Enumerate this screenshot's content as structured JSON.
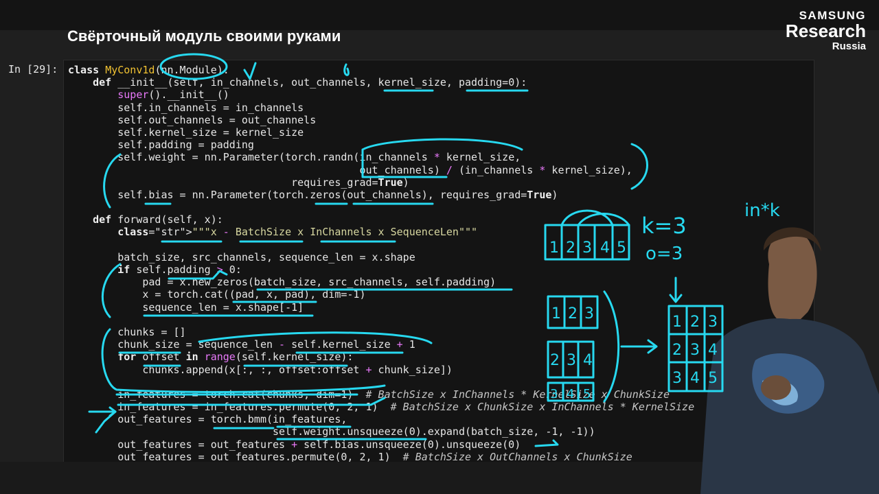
{
  "slide": {
    "title": "Свёрточный модуль своими руками",
    "brand": {
      "line1": "SAMSUNG",
      "line2": "Research",
      "line3": "Russia"
    }
  },
  "cell": {
    "prompt": "In [29]:",
    "lines": [
      "class MyConv1d(nn.Module):",
      "    def __init__(self, in_channels, out_channels, kernel_size, padding=0):",
      "        super().__init__()",
      "        self.in_channels = in_channels",
      "        self.out_channels = out_channels",
      "        self.kernel_size = kernel_size",
      "        self.padding = padding",
      "        self.weight = nn.Parameter(torch.randn(in_channels * kernel_size,",
      "                                               out_channels) / (in_channels * kernel_size),",
      "                                    requires_grad=True)",
      "        self.bias = nn.Parameter(torch.zeros(out_channels), requires_grad=True)",
      "",
      "    def forward(self, x):",
      "        \"\"\"x - BatchSize x InChannels x SequenceLen\"\"\"",
      "",
      "        batch_size, src_channels, sequence_len = x.shape",
      "        if self.padding > 0:",
      "            pad = x.new_zeros(batch_size, src_channels, self.padding)",
      "            x = torch.cat((pad, x, pad), dim=-1)",
      "            sequence_len = x.shape[-1]",
      "",
      "        chunks = []",
      "        chunk_size = sequence_len - self.kernel_size + 1",
      "        for offset in range(self.kernel_size):",
      "            chunks.append(x[:, :, offset:offset + chunk_size])",
      "",
      "        in_features = torch.cat(chunks, dim=1)  # BatchSize x InChannels * KernelSize x ChunkSize",
      "        in_features = in_features.permute(0, 2, 1)  # BatchSize x ChunkSize x InChannels * KernelSize",
      "        out_features = torch.bmm(in_features,",
      "                                 self.weight.unsqueeze(0).expand(batch_size, -1, -1))",
      "        out_features = out_features + self.bias.unsqueeze(0).unsqueeze(0)",
      "        out_features = out_features.permute(0, 2, 1)  # BatchSize x OutChannels x ChunkSize"
    ]
  },
  "annotations": {
    "k_label": "k=3",
    "o_label": "o=3",
    "inxk_label": "in*k",
    "row_cells": [
      "1",
      "2",
      "3",
      "4",
      "5"
    ],
    "chunk1": [
      "1",
      "2",
      "3"
    ],
    "chunk2": [
      "2",
      "3",
      "4"
    ],
    "chunk3": [
      "3",
      "4",
      "5"
    ],
    "matrix": [
      "1",
      "2",
      "3",
      "2",
      "3",
      "4",
      "3",
      "4",
      "5"
    ]
  },
  "colors": {
    "ink": "#27d9f0",
    "keyword_purple": "#e879f9",
    "class_yellow": "#f1c232"
  }
}
